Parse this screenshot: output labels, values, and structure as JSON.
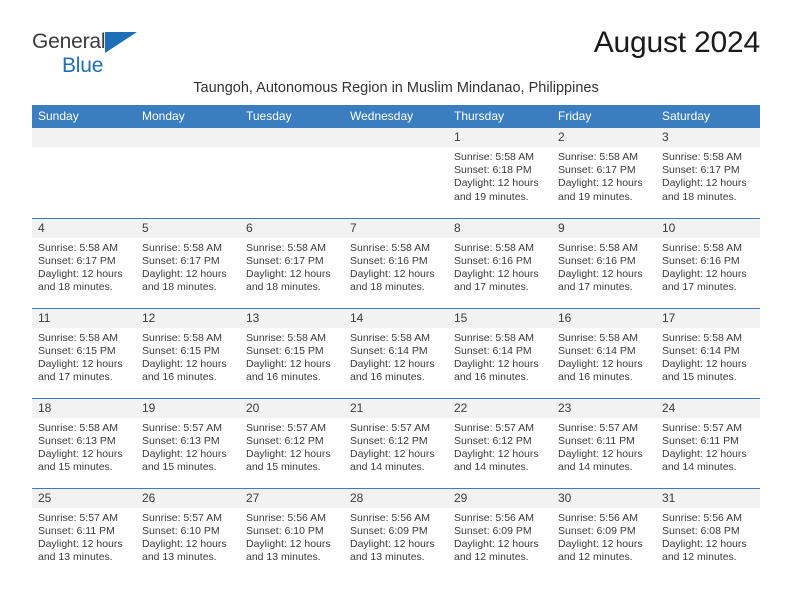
{
  "brand": {
    "name_top": "General",
    "name_bottom": "Blue",
    "triangle_color": "#1d70b8",
    "text_color": "#3b3b3b"
  },
  "header": {
    "month_title": "August 2024",
    "subtitle": "Taungoh, Autonomous Region in Muslim Mindanao, Philippines"
  },
  "theme": {
    "header_bg": "#3a7ebf",
    "header_text": "#ffffff",
    "daynum_bg": "#f2f2f2",
    "body_text": "#3b3b3b"
  },
  "weekday_headers": [
    "Sunday",
    "Monday",
    "Tuesday",
    "Wednesday",
    "Thursday",
    "Friday",
    "Saturday"
  ],
  "weeks": [
    [
      {
        "day": "",
        "sunrise": "",
        "sunset": "",
        "daylight_line1": "",
        "daylight_line2": "",
        "empty": true
      },
      {
        "day": "",
        "sunrise": "",
        "sunset": "",
        "daylight_line1": "",
        "daylight_line2": "",
        "empty": true
      },
      {
        "day": "",
        "sunrise": "",
        "sunset": "",
        "daylight_line1": "",
        "daylight_line2": "",
        "empty": true
      },
      {
        "day": "",
        "sunrise": "",
        "sunset": "",
        "daylight_line1": "",
        "daylight_line2": "",
        "empty": true
      },
      {
        "day": "1",
        "sunrise": "Sunrise: 5:58 AM",
        "sunset": "Sunset: 6:18 PM",
        "daylight_line1": "Daylight: 12 hours",
        "daylight_line2": "and 19 minutes.",
        "empty": false
      },
      {
        "day": "2",
        "sunrise": "Sunrise: 5:58 AM",
        "sunset": "Sunset: 6:17 PM",
        "daylight_line1": "Daylight: 12 hours",
        "daylight_line2": "and 19 minutes.",
        "empty": false
      },
      {
        "day": "3",
        "sunrise": "Sunrise: 5:58 AM",
        "sunset": "Sunset: 6:17 PM",
        "daylight_line1": "Daylight: 12 hours",
        "daylight_line2": "and 18 minutes.",
        "empty": false
      }
    ],
    [
      {
        "day": "4",
        "sunrise": "Sunrise: 5:58 AM",
        "sunset": "Sunset: 6:17 PM",
        "daylight_line1": "Daylight: 12 hours",
        "daylight_line2": "and 18 minutes.",
        "empty": false
      },
      {
        "day": "5",
        "sunrise": "Sunrise: 5:58 AM",
        "sunset": "Sunset: 6:17 PM",
        "daylight_line1": "Daylight: 12 hours",
        "daylight_line2": "and 18 minutes.",
        "empty": false
      },
      {
        "day": "6",
        "sunrise": "Sunrise: 5:58 AM",
        "sunset": "Sunset: 6:17 PM",
        "daylight_line1": "Daylight: 12 hours",
        "daylight_line2": "and 18 minutes.",
        "empty": false
      },
      {
        "day": "7",
        "sunrise": "Sunrise: 5:58 AM",
        "sunset": "Sunset: 6:16 PM",
        "daylight_line1": "Daylight: 12 hours",
        "daylight_line2": "and 18 minutes.",
        "empty": false
      },
      {
        "day": "8",
        "sunrise": "Sunrise: 5:58 AM",
        "sunset": "Sunset: 6:16 PM",
        "daylight_line1": "Daylight: 12 hours",
        "daylight_line2": "and 17 minutes.",
        "empty": false
      },
      {
        "day": "9",
        "sunrise": "Sunrise: 5:58 AM",
        "sunset": "Sunset: 6:16 PM",
        "daylight_line1": "Daylight: 12 hours",
        "daylight_line2": "and 17 minutes.",
        "empty": false
      },
      {
        "day": "10",
        "sunrise": "Sunrise: 5:58 AM",
        "sunset": "Sunset: 6:16 PM",
        "daylight_line1": "Daylight: 12 hours",
        "daylight_line2": "and 17 minutes.",
        "empty": false
      }
    ],
    [
      {
        "day": "11",
        "sunrise": "Sunrise: 5:58 AM",
        "sunset": "Sunset: 6:15 PM",
        "daylight_line1": "Daylight: 12 hours",
        "daylight_line2": "and 17 minutes.",
        "empty": false
      },
      {
        "day": "12",
        "sunrise": "Sunrise: 5:58 AM",
        "sunset": "Sunset: 6:15 PM",
        "daylight_line1": "Daylight: 12 hours",
        "daylight_line2": "and 16 minutes.",
        "empty": false
      },
      {
        "day": "13",
        "sunrise": "Sunrise: 5:58 AM",
        "sunset": "Sunset: 6:15 PM",
        "daylight_line1": "Daylight: 12 hours",
        "daylight_line2": "and 16 minutes.",
        "empty": false
      },
      {
        "day": "14",
        "sunrise": "Sunrise: 5:58 AM",
        "sunset": "Sunset: 6:14 PM",
        "daylight_line1": "Daylight: 12 hours",
        "daylight_line2": "and 16 minutes.",
        "empty": false
      },
      {
        "day": "15",
        "sunrise": "Sunrise: 5:58 AM",
        "sunset": "Sunset: 6:14 PM",
        "daylight_line1": "Daylight: 12 hours",
        "daylight_line2": "and 16 minutes.",
        "empty": false
      },
      {
        "day": "16",
        "sunrise": "Sunrise: 5:58 AM",
        "sunset": "Sunset: 6:14 PM",
        "daylight_line1": "Daylight: 12 hours",
        "daylight_line2": "and 16 minutes.",
        "empty": false
      },
      {
        "day": "17",
        "sunrise": "Sunrise: 5:58 AM",
        "sunset": "Sunset: 6:14 PM",
        "daylight_line1": "Daylight: 12 hours",
        "daylight_line2": "and 15 minutes.",
        "empty": false
      }
    ],
    [
      {
        "day": "18",
        "sunrise": "Sunrise: 5:58 AM",
        "sunset": "Sunset: 6:13 PM",
        "daylight_line1": "Daylight: 12 hours",
        "daylight_line2": "and 15 minutes.",
        "empty": false
      },
      {
        "day": "19",
        "sunrise": "Sunrise: 5:57 AM",
        "sunset": "Sunset: 6:13 PM",
        "daylight_line1": "Daylight: 12 hours",
        "daylight_line2": "and 15 minutes.",
        "empty": false
      },
      {
        "day": "20",
        "sunrise": "Sunrise: 5:57 AM",
        "sunset": "Sunset: 6:12 PM",
        "daylight_line1": "Daylight: 12 hours",
        "daylight_line2": "and 15 minutes.",
        "empty": false
      },
      {
        "day": "21",
        "sunrise": "Sunrise: 5:57 AM",
        "sunset": "Sunset: 6:12 PM",
        "daylight_line1": "Daylight: 12 hours",
        "daylight_line2": "and 14 minutes.",
        "empty": false
      },
      {
        "day": "22",
        "sunrise": "Sunrise: 5:57 AM",
        "sunset": "Sunset: 6:12 PM",
        "daylight_line1": "Daylight: 12 hours",
        "daylight_line2": "and 14 minutes.",
        "empty": false
      },
      {
        "day": "23",
        "sunrise": "Sunrise: 5:57 AM",
        "sunset": "Sunset: 6:11 PM",
        "daylight_line1": "Daylight: 12 hours",
        "daylight_line2": "and 14 minutes.",
        "empty": false
      },
      {
        "day": "24",
        "sunrise": "Sunrise: 5:57 AM",
        "sunset": "Sunset: 6:11 PM",
        "daylight_line1": "Daylight: 12 hours",
        "daylight_line2": "and 14 minutes.",
        "empty": false
      }
    ],
    [
      {
        "day": "25",
        "sunrise": "Sunrise: 5:57 AM",
        "sunset": "Sunset: 6:11 PM",
        "daylight_line1": "Daylight: 12 hours",
        "daylight_line2": "and 13 minutes.",
        "empty": false
      },
      {
        "day": "26",
        "sunrise": "Sunrise: 5:57 AM",
        "sunset": "Sunset: 6:10 PM",
        "daylight_line1": "Daylight: 12 hours",
        "daylight_line2": "and 13 minutes.",
        "empty": false
      },
      {
        "day": "27",
        "sunrise": "Sunrise: 5:56 AM",
        "sunset": "Sunset: 6:10 PM",
        "daylight_line1": "Daylight: 12 hours",
        "daylight_line2": "and 13 minutes.",
        "empty": false
      },
      {
        "day": "28",
        "sunrise": "Sunrise: 5:56 AM",
        "sunset": "Sunset: 6:09 PM",
        "daylight_line1": "Daylight: 12 hours",
        "daylight_line2": "and 13 minutes.",
        "empty": false
      },
      {
        "day": "29",
        "sunrise": "Sunrise: 5:56 AM",
        "sunset": "Sunset: 6:09 PM",
        "daylight_line1": "Daylight: 12 hours",
        "daylight_line2": "and 12 minutes.",
        "empty": false
      },
      {
        "day": "30",
        "sunrise": "Sunrise: 5:56 AM",
        "sunset": "Sunset: 6:09 PM",
        "daylight_line1": "Daylight: 12 hours",
        "daylight_line2": "and 12 minutes.",
        "empty": false
      },
      {
        "day": "31",
        "sunrise": "Sunrise: 5:56 AM",
        "sunset": "Sunset: 6:08 PM",
        "daylight_line1": "Daylight: 12 hours",
        "daylight_line2": "and 12 minutes.",
        "empty": false
      }
    ]
  ]
}
